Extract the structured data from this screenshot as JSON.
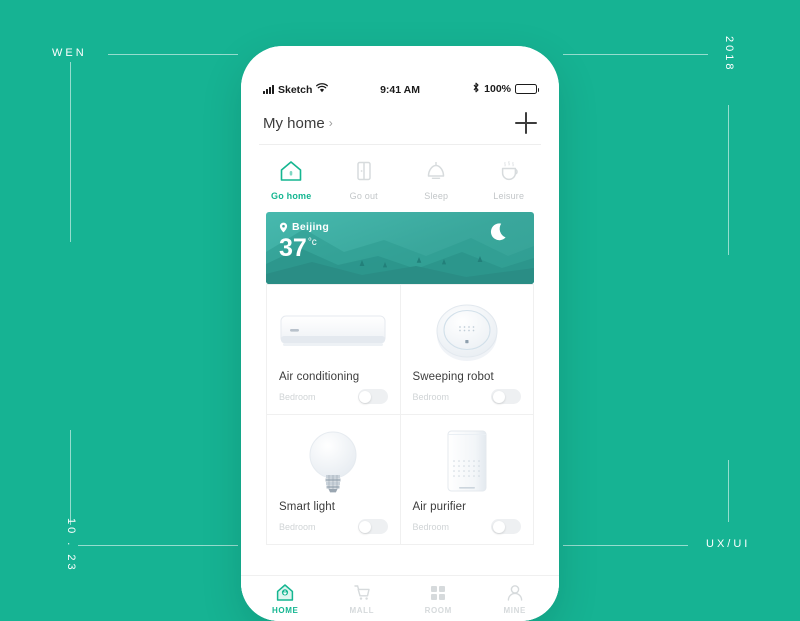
{
  "canvas": {
    "background_color": "#16b393",
    "annotations": {
      "top_left": "WEN",
      "top_right": "2018",
      "bottom_left": "10 . 23",
      "bottom_right": "UX/UI"
    }
  },
  "status_bar": {
    "carrier": "Sketch",
    "time": "9:41 AM",
    "battery_percent": "100%",
    "signal_icon": "signal-bars-icon",
    "wifi_icon": "wifi-icon",
    "bluetooth_icon": "bluetooth-icon",
    "battery_icon": "battery-icon"
  },
  "app_header": {
    "title": "My home",
    "chevron": "›",
    "add_icon": "plus-icon"
  },
  "scenes": [
    {
      "label": "Go home",
      "icon": "house-icon",
      "active": true
    },
    {
      "label": "Go out",
      "icon": "door-icon",
      "active": false
    },
    {
      "label": "Sleep",
      "icon": "lamp-icon",
      "active": false
    },
    {
      "label": "Leisure",
      "icon": "cup-icon",
      "active": false
    }
  ],
  "weather": {
    "city": "Beijing",
    "location_icon": "location-pin-icon",
    "temperature": "37",
    "unit": "°c",
    "condition_icon": "crescent-moon-icon",
    "gradient_from": "#47b9ae",
    "gradient_to": "#35a296"
  },
  "devices": [
    {
      "name": "Air conditioning",
      "room": "Bedroom",
      "icon": "air-conditioner-icon",
      "on": false
    },
    {
      "name": "Sweeping robot",
      "room": "Bedroom",
      "icon": "robot-vacuum-icon",
      "on": false
    },
    {
      "name": "Smart light",
      "room": "Bedroom",
      "icon": "light-bulb-icon",
      "on": false
    },
    {
      "name": "Air purifier",
      "room": "Bedroom",
      "icon": "air-purifier-icon",
      "on": false
    }
  ],
  "tabs": [
    {
      "label": "HOME",
      "icon": "home-icon",
      "active": true
    },
    {
      "label": "MALL",
      "icon": "cart-icon",
      "active": false
    },
    {
      "label": "ROOM",
      "icon": "grid-icon",
      "active": false
    },
    {
      "label": "MINE",
      "icon": "person-icon",
      "active": false
    }
  ],
  "accent_color": "#15b691"
}
